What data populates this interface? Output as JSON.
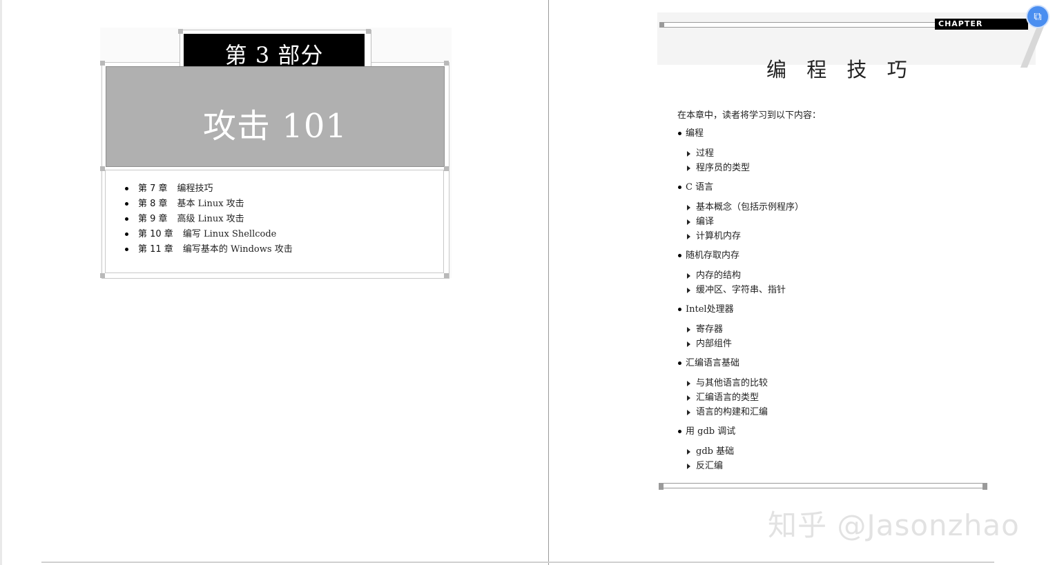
{
  "left_page": {
    "part_label": "第 3 部分",
    "part_title": "攻击 101",
    "chapters": [
      {
        "num": "第 7 章",
        "title": "编程技巧"
      },
      {
        "num": "第 8 章",
        "title": "基本 Linux 攻击"
      },
      {
        "num": "第 9 章",
        "title": "高级 Linux 攻击"
      },
      {
        "num": "第 10 章",
        "title": "编写 Linux Shellcode"
      },
      {
        "num": "第 11 章",
        "title": "编写基本的 Windows 攻击"
      }
    ]
  },
  "right_page": {
    "chapter_tag": "CHAPTER",
    "chapter_title": "编 程 技 巧",
    "intro": "在本章中，读者将学习到以下内容：",
    "outline": [
      {
        "label": "编程",
        "items": [
          "过程",
          "程序员的类型"
        ]
      },
      {
        "label": "C 语言",
        "items": [
          "基本概念（包括示例程序）",
          "编译",
          "计算机内存"
        ]
      },
      {
        "label": "随机存取内存",
        "items": [
          "内存的结构",
          "缓冲区、字符串、指针"
        ]
      },
      {
        "label": "Intel处理器",
        "items": [
          "寄存器",
          "内部组件"
        ]
      },
      {
        "label": "汇编语言基础",
        "items": [
          "与其他语言的比较",
          "汇编语言的类型",
          "语言的构建和汇编"
        ]
      },
      {
        "label": "用 gdb 调试",
        "items": [
          "gdb 基础",
          "反汇编"
        ]
      }
    ]
  },
  "watermark": "知乎 @Jasonzhao",
  "corner_button_icon": "translate-icon"
}
